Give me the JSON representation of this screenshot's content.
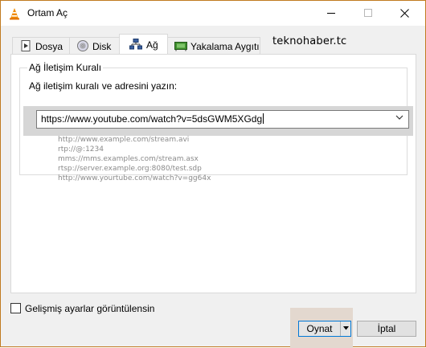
{
  "window": {
    "title": "Ortam Aç",
    "brand": "teknohaber.tc"
  },
  "tabs": [
    {
      "label": "Dosya",
      "icon": "file-icon",
      "active": false
    },
    {
      "label": "Disk",
      "icon": "disc-icon",
      "active": false
    },
    {
      "label": "Ağ",
      "icon": "network-icon",
      "active": true
    },
    {
      "label": "Yakalama Aygıtı",
      "icon": "capture-device-icon",
      "active": false
    }
  ],
  "network": {
    "group_title": "Ağ İletişim Kuralı",
    "url_label": "Ağ iletişim kuralı ve adresini yazın:",
    "url_value": "https://www.youtube.com/watch?v=5dsGWM5XGdg",
    "examples": [
      "http://www.example.com/stream.avi",
      "rtp://@:1234",
      "mms://mms.examples.com/stream.asx",
      "rtsp://server.example.org:8080/test.sdp",
      "http://www.yourtube.com/watch?v=gg64x"
    ]
  },
  "footer": {
    "advanced_label": "Gelişmiş ayarlar görüntülensin",
    "advanced_checked": false,
    "play_label": "Oynat",
    "cancel_label": "İptal"
  },
  "colors": {
    "accent": "#0078d7",
    "window_border": "#c07a20",
    "highlight_band": "#d6d6d6"
  }
}
